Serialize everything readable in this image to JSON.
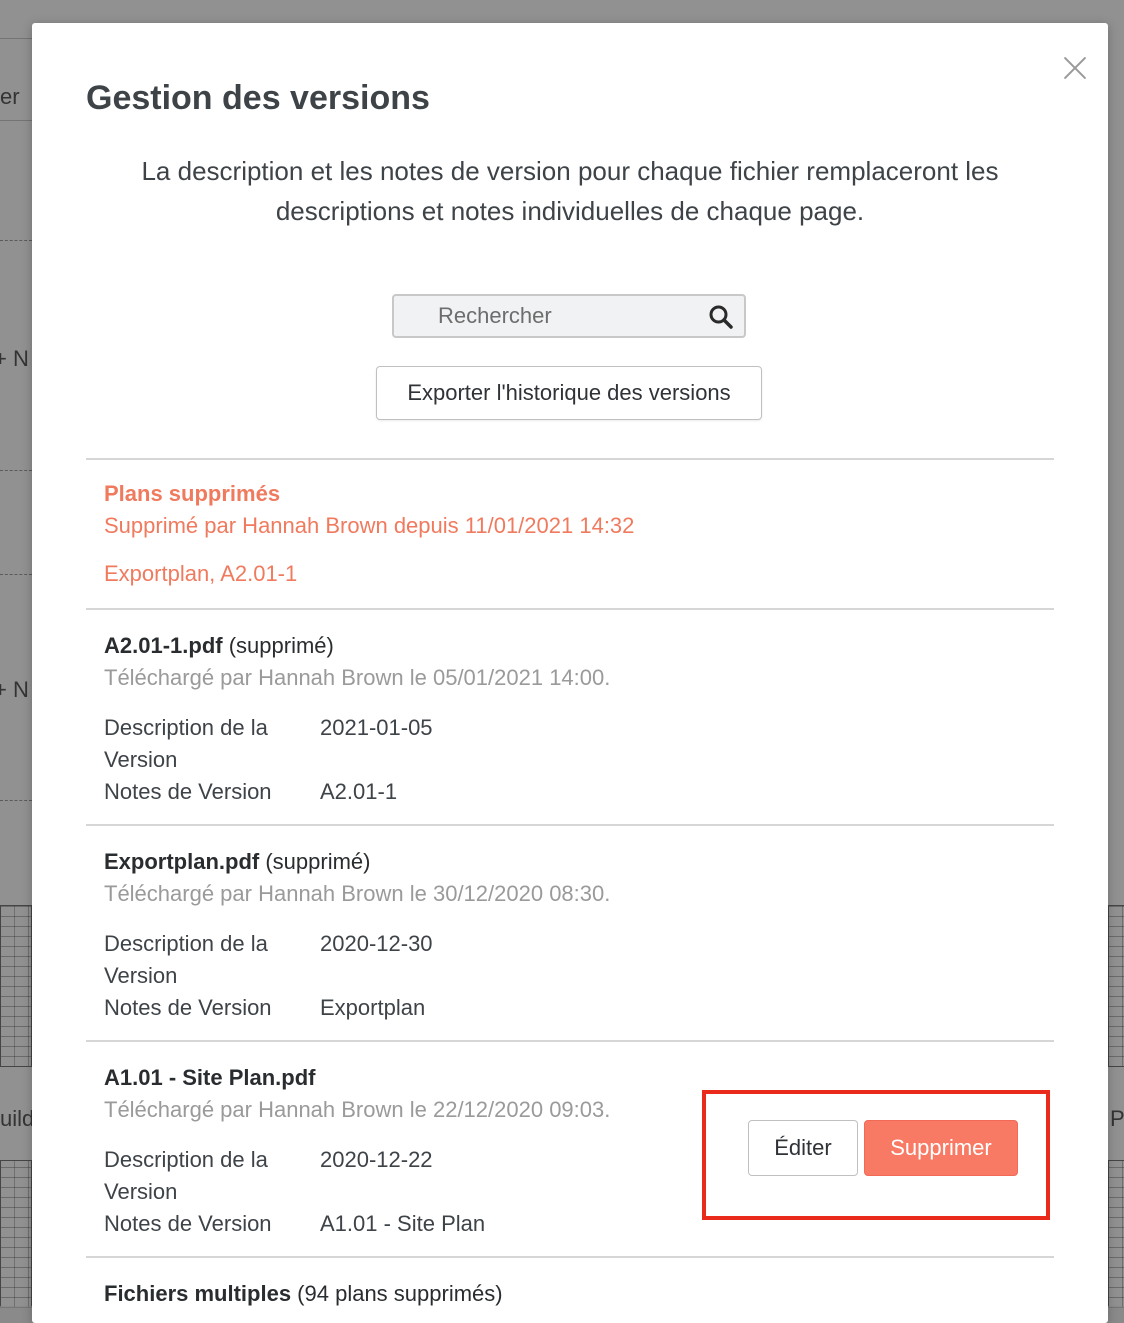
{
  "background": {
    "fragments": [
      "er",
      "+ N",
      "+ N",
      "uildi",
      "P"
    ]
  },
  "modal": {
    "title": "Gestion des versions",
    "intro": "La description et les notes de version pour chaque fichier remplaceront les descriptions et notes individuelles de chaque page.",
    "search": {
      "placeholder": "Rechercher"
    },
    "export_label": "Exporter l'historique des versions",
    "deleted_plans": {
      "title": "Plans supprimés",
      "deleted_by": "Supprimé par Hannah Brown depuis 11/01/2021 14:32",
      "files": "Exportplan, A2.01-1"
    },
    "files": [
      {
        "name": "A2.01-1.pdf",
        "suffix": " (supprimé)",
        "uploaded": "Téléchargé par Hannah Brown le 05/01/2021 14:00.",
        "desc_label": "Description de la Version",
        "desc_value": "2021-01-05",
        "notes_label": "Notes de Version",
        "notes_value": "A2.01-1"
      },
      {
        "name": "Exportplan.pdf",
        "suffix": " (supprimé)",
        "uploaded": "Téléchargé par Hannah Brown le 30/12/2020 08:30.",
        "desc_label": "Description de la Version",
        "desc_value": "2020-12-30",
        "notes_label": "Notes de Version",
        "notes_value": "Exportplan"
      },
      {
        "name": "A1.01 - Site Plan.pdf",
        "suffix": "",
        "uploaded": "Téléchargé par Hannah Brown le 22/12/2020 09:03.",
        "desc_label": "Description de la Version",
        "desc_value": "2020-12-22",
        "notes_label": "Notes de Version",
        "notes_value": "A1.01 - Site Plan"
      }
    ],
    "actions": {
      "edit": "Éditer",
      "delete": "Supprimer"
    },
    "multiple": {
      "name": "Fichiers multiples",
      "suffix": " (94 plans supprimés)"
    }
  },
  "colors": {
    "accent_deleted": "#f07a5e",
    "delete_button": "#f87a64",
    "highlight": "#ea2a1a"
  }
}
